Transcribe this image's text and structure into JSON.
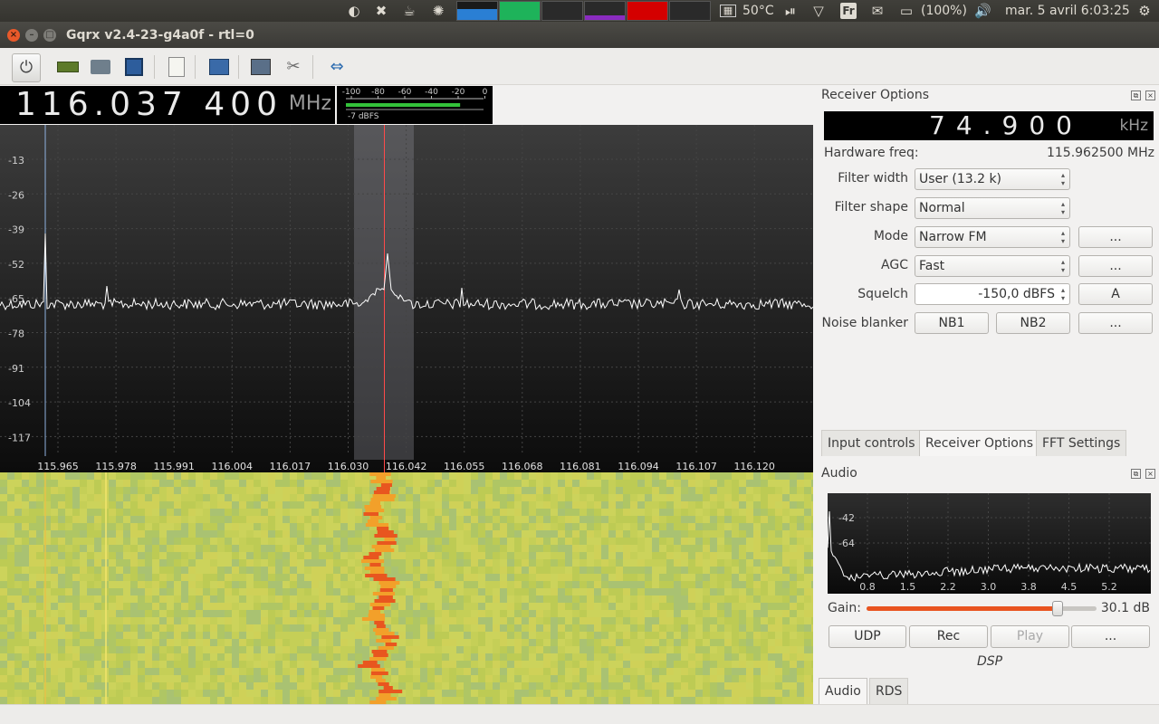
{
  "system_panel": {
    "temperature": "50°C",
    "keyboard_layout": "Fr",
    "battery": "(100%)",
    "datetime": "mar. 5 avril  6:03:25"
  },
  "window": {
    "title": "Gqrx v2.4-23-g4a0f - rtl=0"
  },
  "toolbar": {
    "items": [
      "power-icon",
      "hardware-icon",
      "open-folder-icon",
      "save-icon",
      "bookmark-icon",
      "dsp-icon",
      "io-settings-icon",
      "tools-icon",
      "fullscreen-icon"
    ]
  },
  "frequency": {
    "value": "116.037 400",
    "unit": "MHz"
  },
  "smeter": {
    "scale": [
      "-100",
      "-80",
      "-60",
      "-40",
      "-20",
      "0"
    ],
    "reading": "-7 dBFS",
    "level_fraction": 0.83
  },
  "plotter": {
    "y_labels": [
      "-13",
      "-26",
      "-39",
      "-52",
      "-65",
      "-78",
      "-91",
      "-104",
      "-117"
    ],
    "x_labels": [
      "115.965",
      "115.978",
      "115.991",
      "116.004",
      "116.017",
      "116.030",
      "116.042",
      "116.055",
      "116.068",
      "116.081",
      "116.094",
      "116.107",
      "116.120"
    ]
  },
  "receiver_options": {
    "title": "Receiver Options",
    "offset_value": "74.900",
    "offset_unit": "kHz",
    "hw_freq_label": "Hardware freq:",
    "hw_freq_value": "115.962500 MHz",
    "filter_width_label": "Filter width",
    "filter_width_value": "User (13.2 k)",
    "filter_shape_label": "Filter shape",
    "filter_shape_value": "Normal",
    "mode_label": "Mode",
    "mode_value": "Narrow FM",
    "agc_label": "AGC",
    "agc_value": "Fast",
    "squelch_label": "Squelch",
    "squelch_value": "-150,0 dBFS",
    "squelch_auto": "A",
    "noise_blanker_label": "Noise blanker",
    "nb1": "NB1",
    "nb2": "NB2",
    "more": "..."
  },
  "tabs": [
    "Input controls",
    "Receiver Options",
    "FFT Settings"
  ],
  "audio": {
    "title": "Audio",
    "y_labels": [
      "-42",
      "-64"
    ],
    "x_labels": [
      "0.8",
      "1.5",
      "2.2",
      "3.0",
      "3.8",
      "4.5",
      "5.2"
    ],
    "gain_label": "Gain:",
    "gain_value": "30.1 dB",
    "gain_fraction": 0.83,
    "udp": "UDP",
    "rec": "Rec",
    "play": "Play",
    "more": "...",
    "dsp_label": "DSP"
  },
  "bottom_tabs": [
    "Audio",
    "RDS"
  ],
  "colors": {
    "accent_orange": "#e95420",
    "spectrum_trace": "#ffffff",
    "demod_line": "#ff4a4a",
    "waterfall_base": "#c8cf56"
  }
}
